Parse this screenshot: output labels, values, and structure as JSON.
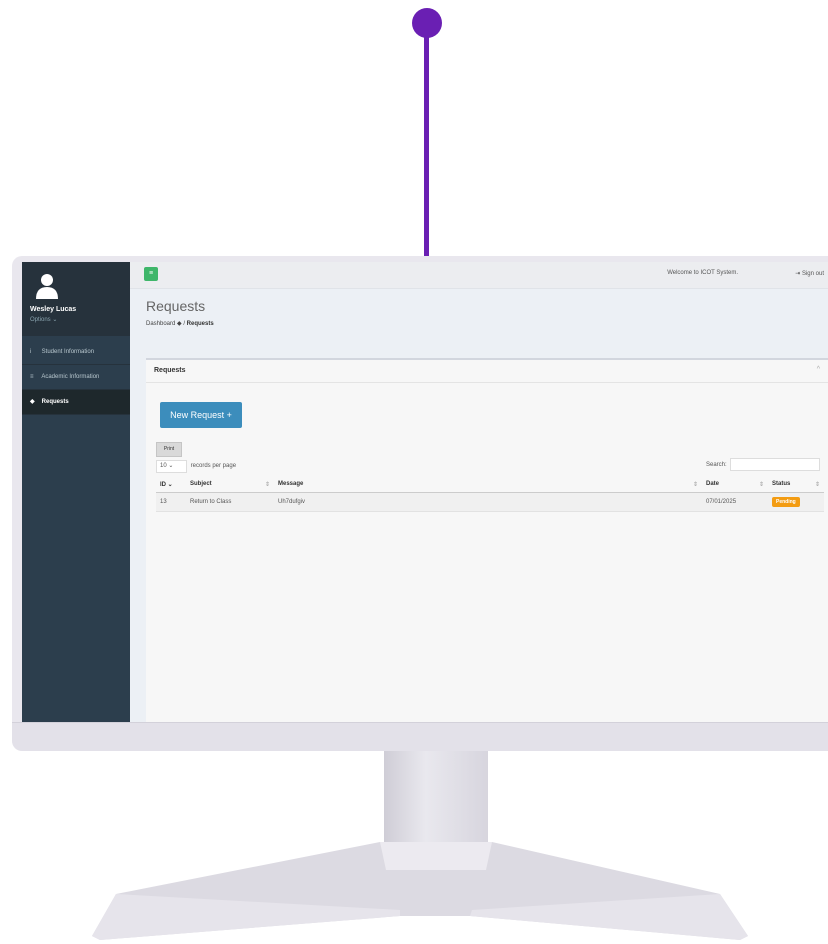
{
  "colors": {
    "accent": "#6a1fb3",
    "sidebar": "#2c3e4d",
    "primary_button": "#3c8dbc",
    "toggle": "#3fb66a",
    "pending": "#f39c12"
  },
  "sidebar": {
    "user": {
      "name": "Wesley Lucas",
      "options": "Options ⌄"
    },
    "items": [
      {
        "icon": "info-icon",
        "glyph": "i",
        "label": "Student Information"
      },
      {
        "icon": "graduation-cap-icon",
        "glyph": "≡",
        "label": "Academic Information"
      },
      {
        "icon": "tag-icon",
        "glyph": "◆",
        "label": "Requests"
      }
    ]
  },
  "topbar": {
    "toggle_icon": "≡",
    "welcome": "Welcome to ICOT System.",
    "signout": "⇥  Sign out"
  },
  "page": {
    "title": "Requests",
    "breadcrumb_root": "Dashboard",
    "breadcrumb_root_icon": "◆",
    "breadcrumb_sep": "/",
    "breadcrumb_current": "Requests"
  },
  "box": {
    "title": "Requests",
    "collapse_icon": "^",
    "new_button": "New Request +",
    "print_button": "Print",
    "length_value": "10",
    "length_chevron": "⌄",
    "length_suffix": "records per page",
    "search_label": "Search:"
  },
  "table": {
    "columns": [
      "ID",
      "Subject",
      "Message",
      "Date",
      "Status"
    ],
    "sort_marks": [
      "⌄",
      "⇕",
      "⇕",
      "⇕",
      "⇕"
    ],
    "rows": [
      {
        "id": "13",
        "subject": "Return to Class",
        "message": "Uh7dufgiv",
        "date": "07/01/2025",
        "status": "Pending"
      }
    ]
  }
}
